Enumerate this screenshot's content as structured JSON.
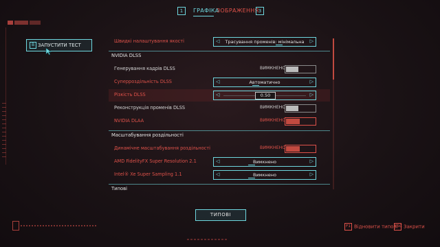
{
  "tabs": {
    "prev_key": "1",
    "next_key": "3",
    "items": [
      {
        "label": "ГРАФІКА",
        "active": true
      },
      {
        "label": "ЗОБРАЖЕННЯ",
        "active": false
      }
    ]
  },
  "test_button": {
    "key": "B",
    "label": "ЗАПУСТИТИ ТЕСТ"
  },
  "settings": {
    "quick_preset": {
      "label": "Швидкі налаштування якості",
      "value": "Трасування променів: мінімальна"
    },
    "sec_dlss": {
      "title": "NVIDIA DLSS"
    },
    "frame_gen": {
      "label": "Генерування кадрів DLSS",
      "state": "ВИМКНЕНО"
    },
    "super_res": {
      "label": "Суперроздільність DLSS",
      "value": "Автоматично"
    },
    "sharpness": {
      "label": "Різкість DLSS",
      "value": "0.50",
      "fraction": 0.5
    },
    "ray_recon": {
      "label": "Реконструкція променів DLSS",
      "state": "ВИМКНЕНО"
    },
    "dlaa": {
      "label": "NVIDIA DLAA",
      "state": "ВИМКНЕНО"
    },
    "sec_scaling": {
      "title": "Масштабування роздільності"
    },
    "dynamic_scaling": {
      "label": "Динамічне масштабування роздільності",
      "state": "ВИМКНЕНО"
    },
    "fsr": {
      "label": "AMD FidelityFX Super Resolution 2.1",
      "value": "Вимкнено"
    },
    "xess": {
      "label": "Intel® Xe Super Sampling 1.1",
      "value": "Вимкнено"
    },
    "sec_basic": {
      "title": "Типові"
    }
  },
  "default_button": {
    "label": "ТИПОВІ"
  },
  "hints": {
    "restore": {
      "key": "F1",
      "label": "Відновити типові"
    },
    "close": {
      "key": "ESC",
      "label": "Закрити"
    }
  },
  "colors": {
    "accent": "#6fd8e0",
    "red": "#e0524a",
    "background": "#1a1215"
  }
}
